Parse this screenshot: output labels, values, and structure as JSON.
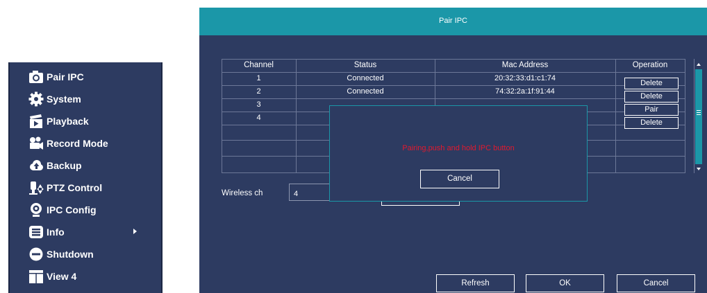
{
  "menu": {
    "items": [
      {
        "label": "Pair IPC",
        "icon": "camera-icon"
      },
      {
        "label": "System",
        "icon": "gear-icon"
      },
      {
        "label": "Playback",
        "icon": "clapperboard-icon"
      },
      {
        "label": "Record Mode",
        "icon": "video-camera-icon"
      },
      {
        "label": "Backup",
        "icon": "cloud-upload-icon"
      },
      {
        "label": "PTZ Control",
        "icon": "ptz-camera-icon"
      },
      {
        "label": "IPC Config",
        "icon": "webcam-icon"
      },
      {
        "label": "Info",
        "icon": "list-icon"
      },
      {
        "label": "Shutdown",
        "icon": "power-icon"
      },
      {
        "label": "View 4",
        "icon": "grid-view-icon"
      }
    ]
  },
  "dialog": {
    "title": "Pair IPC",
    "table": {
      "headers": [
        "Channel",
        "Status",
        "Mac Address",
        "Operation"
      ],
      "rows": [
        {
          "channel": "1",
          "status": "Connected",
          "mac": "20:32:33:d1:c1:74",
          "op": "Delete"
        },
        {
          "channel": "2",
          "status": "Connected",
          "mac": "74:32:2a:1f:91:44",
          "op": "Delete"
        },
        {
          "channel": "3",
          "status": "",
          "mac": "",
          "op": "Pair"
        },
        {
          "channel": "4",
          "status": "",
          "mac": "",
          "op": "Delete"
        }
      ]
    },
    "wireless_label": "Wireless ch",
    "wireless_value": "4",
    "buttons": {
      "refresh": "Refresh",
      "ok": "OK",
      "cancel": "Cancel"
    }
  },
  "popup": {
    "message": "Pairing,push and hold IPC button",
    "cancel_label": "Cancel"
  },
  "colors": {
    "panel": "#2d3b61",
    "header": "#1b97a8",
    "message": "#e2192f"
  }
}
